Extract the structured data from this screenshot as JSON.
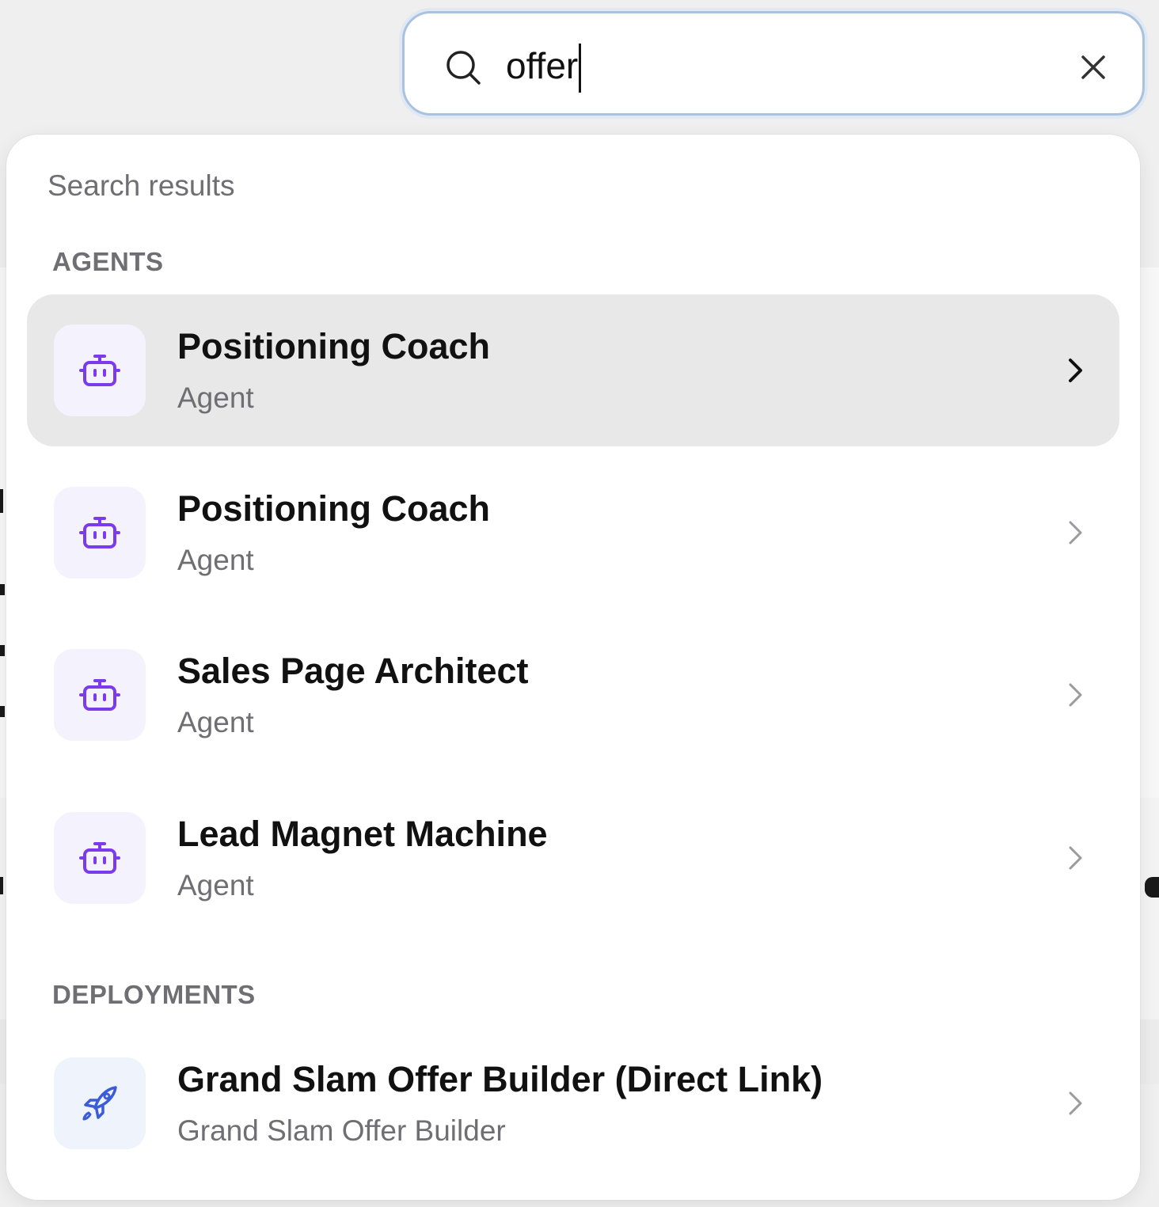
{
  "search": {
    "value": "offer",
    "placeholder": ""
  },
  "results": {
    "title": "Search results",
    "sections": [
      {
        "label": "AGENTS",
        "items": [
          {
            "title": "Positioning Coach",
            "subtitle": "Agent",
            "icon": "robot-icon",
            "selected": true
          },
          {
            "title": "Positioning Coach",
            "subtitle": "Agent",
            "icon": "robot-icon",
            "selected": false
          },
          {
            "title": "Sales Page Architect",
            "subtitle": "Agent",
            "icon": "robot-icon",
            "selected": false
          },
          {
            "title": "Lead Magnet Machine",
            "subtitle": "Agent",
            "icon": "robot-icon",
            "selected": false
          }
        ]
      },
      {
        "label": "DEPLOYMENTS",
        "items": [
          {
            "title": "Grand Slam Offer Builder (Direct Link)",
            "subtitle": "Grand Slam Offer Builder",
            "icon": "rocket-icon",
            "selected": false
          }
        ]
      }
    ]
  },
  "colors": {
    "agent_icon": "#7c3aed",
    "deploy_icon": "#3b5bdb",
    "selected_row": "#e9e8e9",
    "focus_ring": "#a9c2e0"
  }
}
